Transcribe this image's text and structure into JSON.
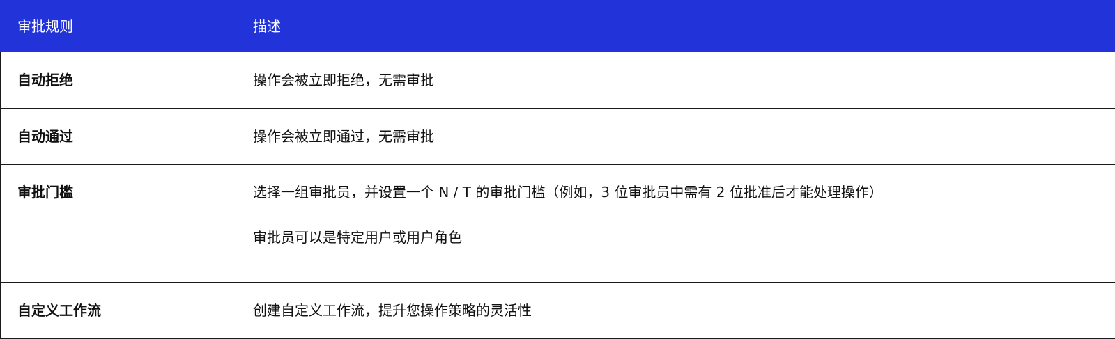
{
  "table": {
    "headers": [
      "审批规则",
      "描述"
    ],
    "rows": [
      {
        "rule": "自动拒绝",
        "description": [
          "操作会被立即拒绝，无需审批"
        ]
      },
      {
        "rule": "自动通过",
        "description": [
          "操作会被立即通过，无需审批"
        ]
      },
      {
        "rule": "审批门槛",
        "description": [
          "选择一组审批员，并设置一个 N / T 的审批门槛（例如，3 位审批员中需有 2 位批准后才能处理操作）",
          "审批员可以是特定用户或用户角色"
        ]
      },
      {
        "rule": "自定义工作流",
        "description": [
          "创建自定义工作流，提升您操作策略的灵活性"
        ]
      }
    ]
  },
  "colors": {
    "header_background": "#2233d9",
    "header_text": "#ffffff",
    "border": "#1a1a1a"
  }
}
